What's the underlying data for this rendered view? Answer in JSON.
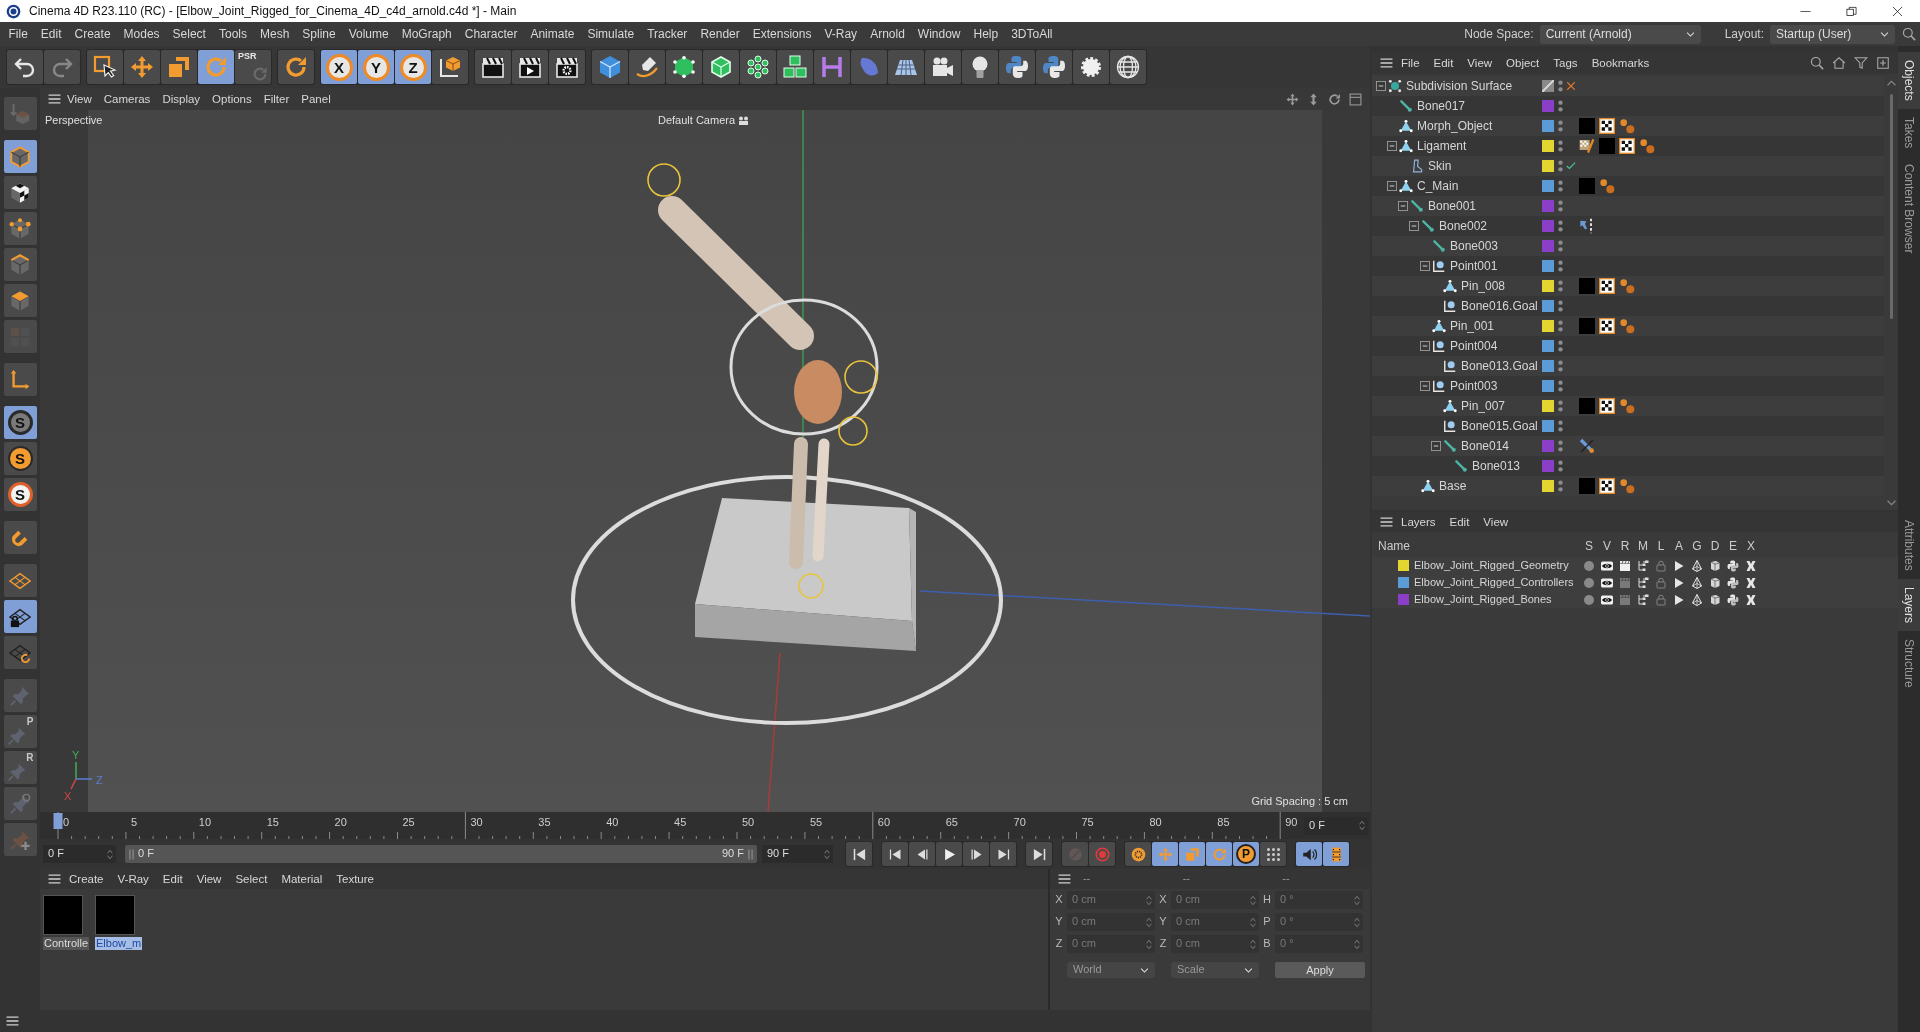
{
  "window": {
    "title": "Cinema 4D R23.110 (RC) - [Elbow_Joint_Rigged_for_Cinema_4D_c4d_arnold.c4d *] - Main"
  },
  "menu_bar": {
    "items": [
      "File",
      "Edit",
      "Create",
      "Modes",
      "Select",
      "Tools",
      "Mesh",
      "Spline",
      "Volume",
      "MoGraph",
      "Character",
      "Animate",
      "Simulate",
      "Tracker",
      "Render",
      "Extensions",
      "V-Ray",
      "Arnold",
      "Window",
      "Help",
      "3DToAll"
    ],
    "node_space": {
      "label": "Node Space:",
      "value": "Current (Arnold)"
    },
    "layout": {
      "label": "Layout:",
      "value": "Startup (User)"
    }
  },
  "toolbar": [
    [
      {
        "kind": "undo",
        "selected": false,
        "disabled": false
      },
      {
        "kind": "redo",
        "selected": false,
        "disabled": true
      }
    ],
    [
      {
        "kind": "select",
        "selected": false,
        "disabled": false
      },
      {
        "kind": "move",
        "selected": false,
        "disabled": false
      },
      {
        "kind": "scale",
        "selected": false,
        "disabled": false
      },
      {
        "kind": "rotate",
        "selected": true,
        "disabled": false
      },
      {
        "kind": "psr",
        "label": "PSR",
        "selected": false,
        "disabled": true
      }
    ],
    [
      {
        "kind": "rotate",
        "selected": false,
        "disabled": false
      }
    ],
    [
      {
        "kind": "axis",
        "label": "X",
        "selected": true,
        "disabled": false
      },
      {
        "kind": "axis",
        "label": "Y",
        "selected": true,
        "disabled": false
      },
      {
        "kind": "axis",
        "label": "Z",
        "selected": true,
        "disabled": false
      },
      {
        "kind": "coords",
        "selected": false,
        "disabled": false
      }
    ],
    [
      {
        "kind": "clapper",
        "selected": false,
        "disabled": false
      },
      {
        "kind": "clapperplay",
        "selected": false,
        "disabled": false
      },
      {
        "kind": "clappergear",
        "selected": false,
        "disabled": false
      }
    ],
    [
      {
        "kind": "cube",
        "selected": false,
        "disabled": false
      },
      {
        "kind": "pen",
        "selected": false,
        "disabled": false
      },
      {
        "kind": "subdiv",
        "selected": false,
        "disabled": false
      },
      {
        "kind": "extrude",
        "selected": false,
        "disabled": false
      },
      {
        "kind": "cloner",
        "selected": false,
        "disabled": false
      },
      {
        "kind": "array",
        "selected": false,
        "disabled": false
      },
      {
        "kind": "symmetry",
        "selected": false,
        "disabled": false
      },
      {
        "kind": "deformer",
        "selected": false,
        "disabled": false
      },
      {
        "kind": "floor",
        "selected": false,
        "disabled": false
      },
      {
        "kind": "camera",
        "selected": false,
        "disabled": false
      },
      {
        "kind": "light",
        "selected": false,
        "disabled": false
      },
      {
        "kind": "python",
        "selected": false,
        "disabled": false
      },
      {
        "kind": "python",
        "selected": false,
        "disabled": false
      },
      {
        "kind": "gear",
        "selected": false,
        "disabled": false
      },
      {
        "kind": "globe",
        "selected": false,
        "disabled": false
      }
    ]
  ],
  "left_toolbar": [
    [
      {
        "kind": "convert",
        "selected": false,
        "disabled": true
      }
    ],
    [
      {
        "kind": "model",
        "selected": true,
        "disabled": false
      },
      {
        "kind": "texture",
        "selected": false,
        "disabled": false
      },
      {
        "kind": "points",
        "selected": false,
        "disabled": false
      },
      {
        "kind": "edges",
        "selected": false,
        "disabled": false
      },
      {
        "kind": "polygons",
        "selected": false,
        "disabled": false
      },
      {
        "kind": "uv",
        "selected": false,
        "disabled": true
      }
    ],
    [
      {
        "kind": "axismode",
        "selected": false,
        "disabled": false
      }
    ],
    [
      {
        "kind": "snap",
        "label": "S",
        "selected": true,
        "disabled": false
      },
      {
        "kind": "snaporange",
        "label": "S",
        "selected": false,
        "disabled": false
      },
      {
        "kind": "snapring",
        "label": "S",
        "selected": false,
        "disabled": false
      }
    ],
    [
      {
        "kind": "magnet",
        "selected": false,
        "disabled": false
      }
    ],
    [
      {
        "kind": "workplane",
        "selected": false,
        "disabled": false
      },
      {
        "kind": "workplanelock",
        "selected": true,
        "disabled": false
      },
      {
        "kind": "workplanealign",
        "selected": false,
        "disabled": false
      }
    ],
    [
      {
        "kind": "pin",
        "selected": false,
        "disabled": true
      },
      {
        "kind": "pin",
        "label": "P",
        "selected": false,
        "disabled": true
      },
      {
        "kind": "pin",
        "label": "R",
        "selected": false,
        "disabled": true
      },
      {
        "kind": "pintarget",
        "selected": false,
        "disabled": true
      },
      {
        "kind": "pinadd",
        "selected": false,
        "disabled": true
      }
    ]
  ],
  "viewport": {
    "menu": [
      "View",
      "Cameras",
      "Display",
      "Options",
      "Filter",
      "Panel"
    ],
    "view_name": "Perspective",
    "camera": "Default Camera",
    "grid_spacing": "Grid Spacing : 5 cm",
    "axis_labels": [
      "Y",
      "Z",
      "X"
    ]
  },
  "timeline": {
    "frames": [
      "0",
      "5",
      "10",
      "15",
      "20",
      "25",
      "30",
      "35",
      "40",
      "45",
      "50",
      "55",
      "60",
      "65",
      "70",
      "75",
      "80",
      "85",
      "90"
    ],
    "level": 0,
    "current_frame": "0 F",
    "start_frame": "0 F",
    "range": {
      "start": "0 F",
      "end": "90 F",
      "level": 1
    },
    "end_frame": "90 F",
    "controls": [
      [
        {
          "kind": "first",
          "selected": false,
          "disabled": false
        }
      ],
      [
        {
          "kind": "prevkey",
          "selected": false,
          "disabled": false
        },
        {
          "kind": "prevframe",
          "selected": false,
          "disabled": false
        },
        {
          "kind": "play",
          "selected": false,
          "disabled": false
        },
        {
          "kind": "nextframe",
          "selected": false,
          "disabled": false
        },
        {
          "kind": "nextkey",
          "selected": false,
          "disabled": false
        }
      ],
      [
        {
          "kind": "last",
          "selected": false,
          "disabled": false
        }
      ],
      [
        {
          "kind": "record",
          "selected": false,
          "disabled": true
        },
        {
          "kind": "autokey",
          "selected": false,
          "disabled": false
        }
      ],
      [
        {
          "kind": "keyall",
          "selected": false,
          "disabled": false
        },
        {
          "kind": "move",
          "selected": true,
          "disabled": false
        },
        {
          "kind": "scale",
          "selected": true,
          "disabled": false
        },
        {
          "kind": "rotate",
          "selected": true,
          "disabled": false
        },
        {
          "kind": "param",
          "label": "P",
          "selected": true,
          "disabled": false
        },
        {
          "kind": "pla",
          "selected": false,
          "disabled": false
        }
      ],
      [
        {
          "kind": "sound",
          "selected": true,
          "disabled": false
        },
        {
          "kind": "film",
          "selected": true,
          "disabled": false
        }
      ]
    ]
  },
  "materials": {
    "menu": [
      "Create",
      "V-Ray",
      "Edit",
      "View",
      "Select",
      "Material",
      "Texture"
    ],
    "items": [
      {
        "name": "Controlle",
        "selected": false
      },
      {
        "name": "Elbow_m",
        "selected": true
      }
    ]
  },
  "coordinates": {
    "headers": [
      "--",
      "--",
      "--"
    ],
    "disabled": true,
    "rows": [
      [
        {
          "axis": "X",
          "value": "0 cm"
        },
        {
          "axis": "X",
          "value": "0 cm"
        },
        {
          "axis": "H",
          "value": "0 °"
        }
      ],
      [
        {
          "axis": "Y",
          "value": "0 cm"
        },
        {
          "axis": "Y",
          "value": "0 cm"
        },
        {
          "axis": "P",
          "value": "0 °"
        }
      ],
      [
        {
          "axis": "Z",
          "value": "0 cm"
        },
        {
          "axis": "Z",
          "value": "0 cm"
        },
        {
          "axis": "B",
          "value": "0 °"
        }
      ]
    ],
    "dropdowns": [
      "World",
      "Scale"
    ],
    "apply": "Apply"
  },
  "objects": {
    "menu": [
      "File",
      "Edit",
      "View",
      "Object",
      "Tags",
      "Bookmarks"
    ],
    "tree": [
      {
        "name": "Subdivision Surface",
        "kind": "subdivision",
        "expanded": true,
        "enabled": false,
        "children": [
          {
            "name": "Bone017",
            "kind": "bone",
            "color": "#8b3fc8"
          },
          {
            "name": "Morph_Object",
            "kind": "polygon",
            "color": "#5b9bd8",
            "tags": [
              {
                "kind": "material"
              },
              {
                "kind": "texture"
              },
              {
                "kind": "vertexmap"
              }
            ]
          },
          {
            "name": "Ligament",
            "kind": "polygon",
            "color": "#e3d630",
            "expanded": true,
            "tags": [
              {
                "kind": "weight"
              },
              {
                "kind": "material"
              },
              {
                "kind": "texture"
              },
              {
                "kind": "vertexmap"
              }
            ],
            "children": [
              {
                "name": "Skin",
                "kind": "skin",
                "color": "#e3d630",
                "enabled": true
              }
            ]
          },
          {
            "name": "C_Main",
            "kind": "polygon",
            "color": "#5b9bd8",
            "expanded": true,
            "tags": [
              {
                "kind": "material"
              },
              {
                "kind": "vertexmap"
              }
            ],
            "children": [
              {
                "name": "Bone001",
                "kind": "bone",
                "color": "#8b3fc8",
                "expanded": true,
                "children": [
                  {
                    "name": "Bone002",
                    "kind": "bone",
                    "color": "#8b3fc8",
                    "expanded": true,
                    "tags": [
                      {
                        "kind": "psr"
                      }
                    ],
                    "children": [
                      {
                        "name": "Bone003",
                        "kind": "bone",
                        "color": "#8b3fc8"
                      },
                      {
                        "name": "Point001",
                        "kind": "point",
                        "color": "#5b9bd8",
                        "expanded": true,
                        "children": [
                          {
                            "name": "Pin_008",
                            "kind": "polygon",
                            "color": "#e3d630",
                            "tags": [
                              {
                                "kind": "material"
                              },
                              {
                                "kind": "texture"
                              },
                              {
                                "kind": "vertexmap"
                              }
                            ]
                          },
                          {
                            "name": "Bone016.Goal",
                            "kind": "point",
                            "color": "#5b9bd8"
                          }
                        ]
                      },
                      {
                        "name": "Pin_001",
                        "kind": "polygon",
                        "color": "#e3d630",
                        "tags": [
                          {
                            "kind": "material"
                          },
                          {
                            "kind": "texture"
                          },
                          {
                            "kind": "vertexmap"
                          }
                        ]
                      },
                      {
                        "name": "Point004",
                        "kind": "point",
                        "color": "#5b9bd8",
                        "expanded": true,
                        "children": [
                          {
                            "name": "Bone013.Goal",
                            "kind": "point",
                            "color": "#5b9bd8"
                          }
                        ]
                      },
                      {
                        "name": "Point003",
                        "kind": "point",
                        "color": "#5b9bd8",
                        "expanded": true,
                        "children": [
                          {
                            "name": "Pin_007",
                            "kind": "polygon",
                            "color": "#e3d630",
                            "tags": [
                              {
                                "kind": "material"
                              },
                              {
                                "kind": "texture"
                              },
                              {
                                "kind": "vertexmap"
                              }
                            ]
                          },
                          {
                            "name": "Bone015.Goal",
                            "kind": "point",
                            "color": "#5b9bd8"
                          },
                          {
                            "name": "Bone014",
                            "kind": "bone",
                            "color": "#8b3fc8",
                            "expanded": true,
                            "tags": [
                              {
                                "kind": "ik"
                              }
                            ],
                            "children": [
                              {
                                "name": "Bone013",
                                "kind": "bone",
                                "color": "#8b3fc8"
                              }
                            ]
                          }
                        ]
                      }
                    ]
                  },
                  {
                    "name": "Base",
                    "kind": "polygon",
                    "color": "#e3d630",
                    "tags": [
                      {
                        "kind": "material"
                      },
                      {
                        "kind": "texture"
                      },
                      {
                        "kind": "vertexmap"
                      }
                    ]
                  }
                ]
              }
            ]
          }
        ]
      }
    ]
  },
  "layers": {
    "menu": [
      "Layers",
      "Edit",
      "View"
    ],
    "columns": [
      "Name",
      "S",
      "V",
      "R",
      "M",
      "L",
      "A",
      "G",
      "D",
      "E",
      "X"
    ],
    "rows": [
      {
        "name": "Elbow_Joint_Rigged_Geometry",
        "color": "#e3d630",
        "render": true
      },
      {
        "name": "Elbow_Joint_Rigged_Controllers",
        "color": "#5b9bd8",
        "render": false
      },
      {
        "name": "Elbow_Joint_Rigged_Bones",
        "color": "#8b3fc8",
        "render": false
      }
    ]
  },
  "side_tabs": {
    "top": [
      {
        "label": "Objects",
        "selected": true
      },
      {
        "label": "Takes",
        "selected": false
      },
      {
        "label": "Content Browser",
        "selected": false
      }
    ],
    "bottom": [
      {
        "label": "Attributes",
        "selected": false
      },
      {
        "label": "Layers",
        "selected": true
      },
      {
        "label": "Structure",
        "selected": false
      }
    ]
  }
}
